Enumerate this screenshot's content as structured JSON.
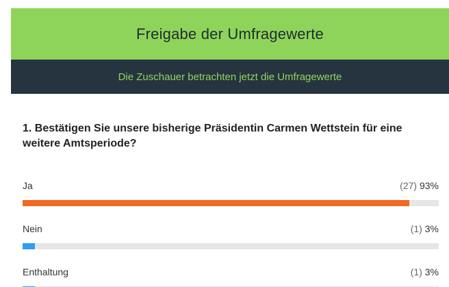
{
  "header": {
    "title": "Freigabe der Umfragewerte",
    "status": "Die Zuschauer betrachten jetzt die Umfragewerte"
  },
  "question": {
    "text": "1. Bestätigen Sie unsere bisherige Präsidentin Carmen Wettstein für eine weitere Amtsperiode?"
  },
  "options": [
    {
      "label": "Ja",
      "count": "(27)",
      "percent": "93%",
      "share": 0.93,
      "color": "#f06a22"
    },
    {
      "label": "Nein",
      "count": "(1)",
      "percent": "3%",
      "share": 0.03,
      "color": "#2d9ef0"
    },
    {
      "label": "Enthaltung",
      "count": "(1)",
      "percent": "3%",
      "share": 0.03,
      "color": "#2d9ef0"
    }
  ]
}
